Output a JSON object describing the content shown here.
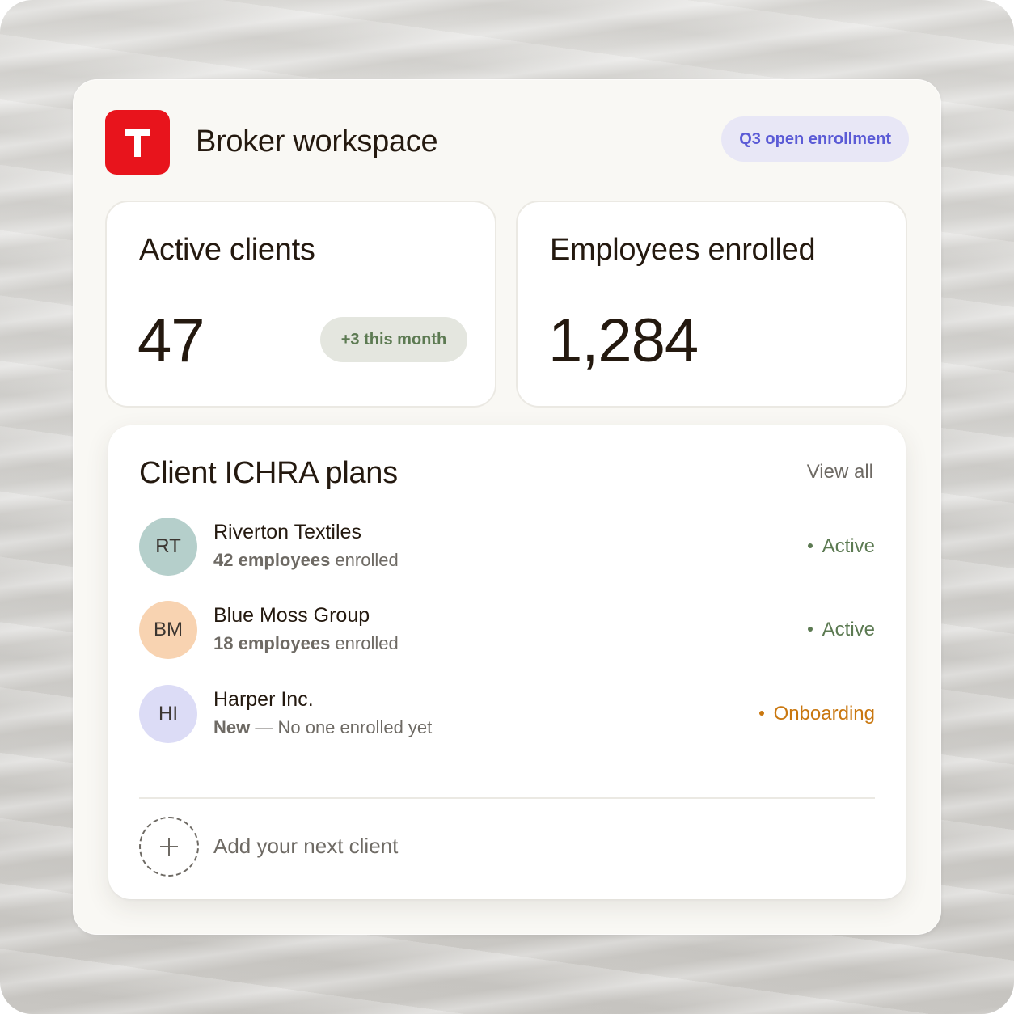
{
  "header": {
    "logo_icon": "t-letter-logo-icon",
    "logo_color": "#e8141c",
    "title": "Broker workspace",
    "badge": "Q3 open enrollment"
  },
  "stats": [
    {
      "label": "Active clients",
      "value": "47",
      "delta": "+3 this month"
    },
    {
      "label": "Employees enrolled",
      "value": "1,284"
    }
  ],
  "plans": {
    "title": "Client ICHRA plans",
    "view_all": "View all",
    "clients": [
      {
        "initials": "RT",
        "name": "Riverton Textiles",
        "sub_bold": "42 employees",
        "sub_rest": " enrolled",
        "status": "Active",
        "status_color": "#5c7a52",
        "avatar_color": "#b5cfcb"
      },
      {
        "initials": "BM",
        "name": "Blue Moss Group",
        "sub_bold": "18 employees",
        "sub_rest": " enrolled",
        "status": "Active",
        "status_color": "#5c7a52",
        "avatar_color": "#f8d3b1"
      },
      {
        "initials": "HI",
        "name": "Harper Inc.",
        "sub_bold": "New",
        "sub_rest": " — No one enrolled yet",
        "status": "Onboarding",
        "status_color": "#c9770f",
        "avatar_color": "#dcdcf6"
      }
    ],
    "add_label": "Add your next client",
    "add_icon": "plus-icon"
  }
}
